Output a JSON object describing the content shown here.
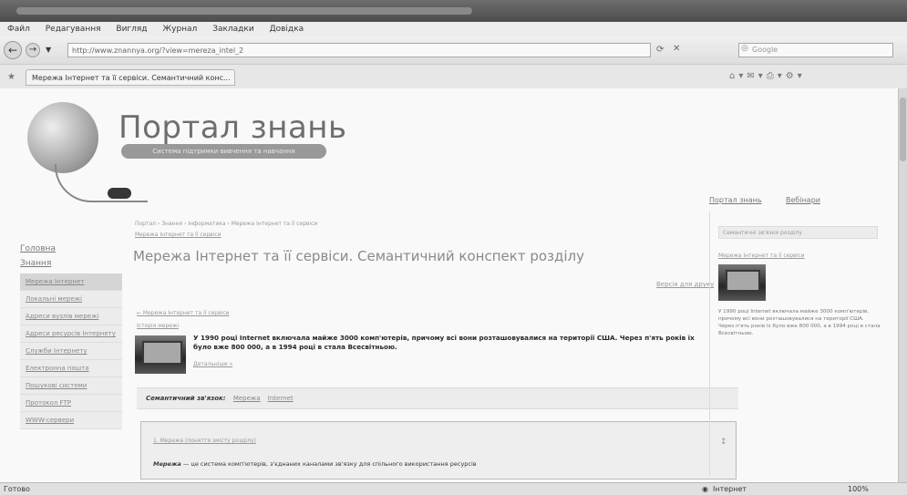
{
  "browser": {
    "menu": [
      "Файл",
      "Редагування",
      "Вигляд",
      "Журнал",
      "Закладки",
      "Довідка"
    ],
    "address": "http://www.znannya.org/?view=mereza_intel_2",
    "search_placeholder": "Google",
    "nav_back_icon": "back-arrow-icon",
    "nav_forward_icon": "forward-arrow-icon",
    "tab_title": "Мережа Інтернет та її сервіси. Семантичний конс...",
    "status_left": "Готово",
    "status_zone": "Інтернет",
    "zoom": "100%"
  },
  "site": {
    "title": "Портал знань",
    "subtitle": "Система підтримки вивчення та навчання"
  },
  "top_links": [
    "Портал знань",
    "Вебінари"
  ],
  "breadcrumbs": "Портал › Знання › Інформатика › Мережа Інтернет та її сервіси",
  "breadcrumbs2": "Мережа Інтернет та її сервіси",
  "left_nav": {
    "links": [
      "Головна",
      "Знання"
    ],
    "items": [
      "Мережа Інтернет",
      "Локальні мережі",
      "Адреси вузлів мережі",
      "Адреси ресурсів Інтернету",
      "Служби Інтернету",
      "Електронна пошта",
      "Пошукові системи",
      "Протокол FTP",
      "WWW-сервери"
    ]
  },
  "main": {
    "title": "Мережа Інтернет та її сервіси. Семантичний конспект розділу",
    "print_link": "Версія для друку",
    "back_link": "← Мережа Інтернет та її сервіси",
    "small_label": "Історія мережі",
    "paragraph": "У 1990 році Internet включала майже 3000 комп'ютерів, причому всі вони розташовувалися на території США. Через п'ять років їх було вже 800 000, а в 1994 році в стала Всесвітньою.",
    "more": "Детальніше »",
    "semantic_label": "Семантичний зв'язок:",
    "semantic_links": [
      "Мережа",
      "Internet"
    ],
    "definition_head": "1. Мережа (поняття змісту розділу)",
    "definition_term": "Мережа",
    "definition_text": " — це система комп'ютерів, з'єднаних каналами зв'язку для спільного використання ресурсів",
    "expand": "↕"
  },
  "right": {
    "box_title": "Семантичні зв'язки розділу",
    "link": "Мережа Інтернет та її сервіси",
    "text": "У 1990 році Internet включала майже 3000 комп'ютерів, причому всі вони розташовувалися на території США. Через п'ять років їх було вже 800 000, а в 1994 році в стала Всесвітньою."
  }
}
